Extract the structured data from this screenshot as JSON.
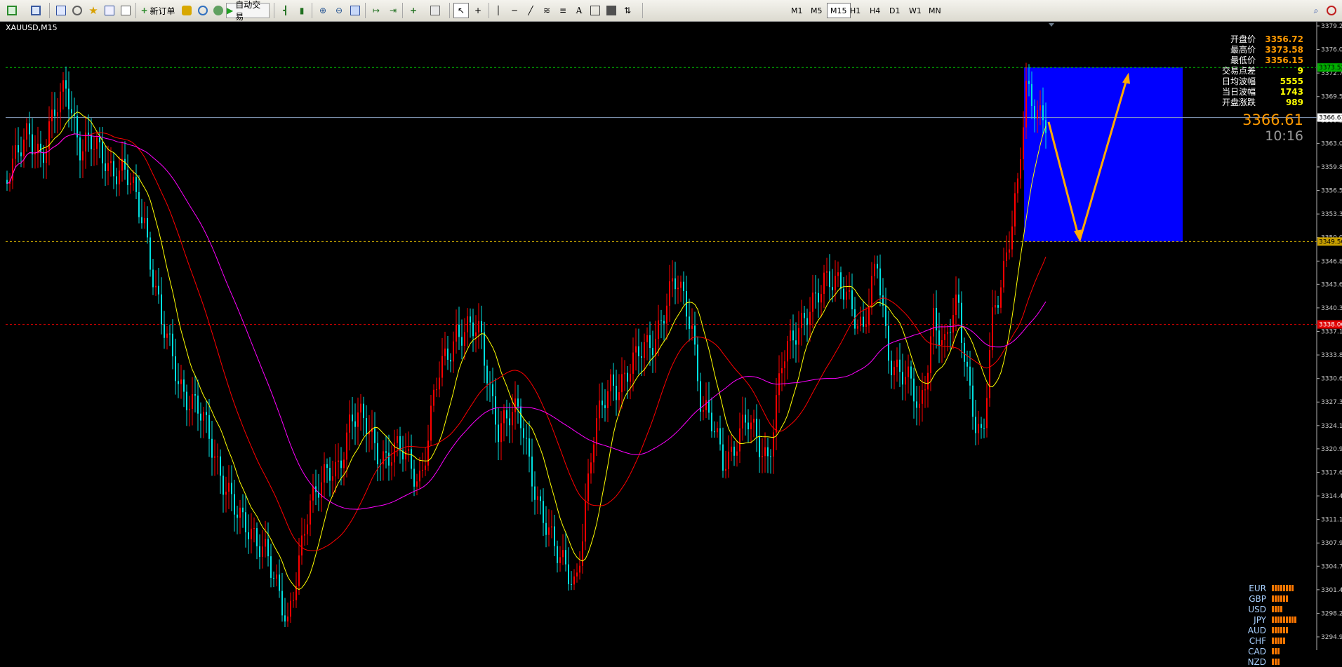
{
  "toolbar": {
    "new_order_label": "新订单",
    "auto_trade_label": "自动交易",
    "timeframes": [
      "M1",
      "M5",
      "M15",
      "H1",
      "H4",
      "D1",
      "W1",
      "MN"
    ],
    "active_timeframe": "M15"
  },
  "chart": {
    "symbol_label": "XAUUSD,M15",
    "info_panel": [
      {
        "label": "开盘价",
        "value": "3356.72",
        "color": "#ff9a00"
      },
      {
        "label": "最高价",
        "value": "3373.58",
        "color": "#ff9a00"
      },
      {
        "label": "最低价",
        "value": "3356.15",
        "color": "#ff9a00"
      },
      {
        "label": "交易点差",
        "value": "9",
        "color": "#ffff00"
      },
      {
        "label": "日均波幅",
        "value": "5555",
        "color": "#ffff00"
      },
      {
        "label": "当日波幅",
        "value": "1743",
        "color": "#ffff00"
      },
      {
        "label": "开盘涨跌",
        "value": "989",
        "color": "#ffff00"
      }
    ],
    "current_price": "3366.61",
    "countdown": "10:16",
    "price_axis_ticks": [
      "3379.25",
      "3376.00",
      "3372.75",
      "3369.50",
      "3366.25",
      "3363.05",
      "3359.80",
      "3356.55",
      "3353.30",
      "3350.05",
      "3346.80",
      "3343.60",
      "3340.35",
      "3337.10",
      "3333.85",
      "3330.60",
      "3327.35",
      "3324.10",
      "3320.90",
      "3317.65",
      "3314.40",
      "3311.15",
      "3307.90",
      "3304.70",
      "3301.45",
      "3298.20",
      "3294.95"
    ],
    "price_axis_markers": [
      {
        "value": "3373.52",
        "bg": "#00b000",
        "fg": "#000000"
      },
      {
        "value": "3366.61",
        "bg": "#ffffff",
        "fg": "#000000"
      },
      {
        "value": "3349.50",
        "bg": "#c8a000",
        "fg": "#000000"
      },
      {
        "value": "3338.06",
        "bg": "#e00000",
        "fg": "#ffffff"
      }
    ],
    "currency_strength": [
      {
        "name": "EUR",
        "level": 8
      },
      {
        "name": "GBP",
        "level": 6
      },
      {
        "name": "USD",
        "level": 4
      },
      {
        "name": "JPY",
        "level": 9
      },
      {
        "name": "AUD",
        "level": 6
      },
      {
        "name": "CHF",
        "level": 5
      },
      {
        "name": "CAD",
        "level": 3
      },
      {
        "name": "NZD",
        "level": 3
      }
    ],
    "colors": {
      "bull_candle": "#ff0000",
      "bear_candle": "#00e0e0",
      "ma_fast": "#ffff00",
      "ma_mid": "#ff0000",
      "ma_slow": "#ff00ff",
      "forecast_box": "#0000ff",
      "arrow": "#ffaa00",
      "resistance_line": "#00c000",
      "support_line": "#d4b000",
      "pivot_line": "#e00000",
      "bid_line": "#8aa0c0"
    }
  }
}
